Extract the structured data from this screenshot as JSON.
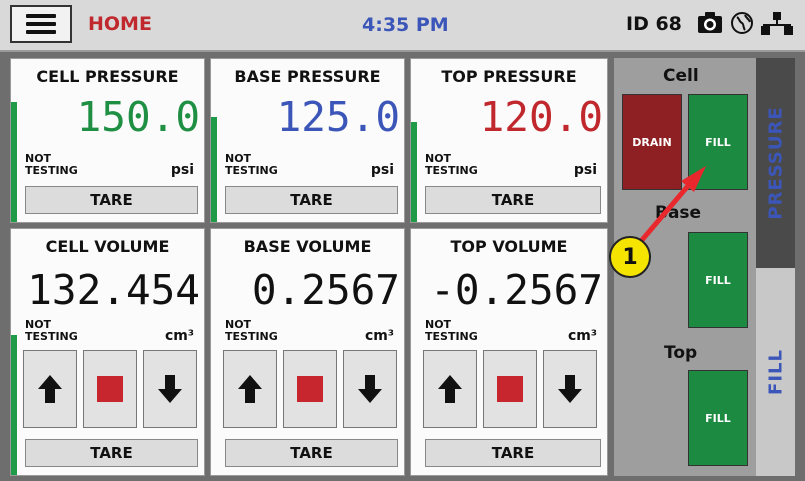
{
  "header": {
    "home": "HOME",
    "time": "4:35 PM",
    "device_id": "ID 68"
  },
  "pressure_panels": [
    {
      "title": "CELL PRESSURE",
      "value": "150.0",
      "status_l1": "NOT",
      "status_l2": "TESTING",
      "unit": "psi",
      "tare": "TARE",
      "color": "#1f8f43"
    },
    {
      "title": "BASE PRESSURE",
      "value": "125.0",
      "status_l1": "NOT",
      "status_l2": "TESTING",
      "unit": "psi",
      "tare": "TARE",
      "color": "#3b56b8"
    },
    {
      "title": "TOP PRESSURE",
      "value": "120.0",
      "status_l1": "NOT",
      "status_l2": "TESTING",
      "unit": "psi",
      "tare": "TARE",
      "color": "#c0282d"
    }
  ],
  "volume_panels": [
    {
      "title": "CELL VOLUME",
      "value": "132.454",
      "status_l1": "NOT",
      "status_l2": "TESTING",
      "unit": "cm³",
      "tare": "TARE"
    },
    {
      "title": "BASE VOLUME",
      "value": "0.2567",
      "status_l1": "NOT",
      "status_l2": "TESTING",
      "unit": "cm³",
      "tare": "TARE"
    },
    {
      "title": "TOP VOLUME",
      "value": "-0.2567",
      "status_l1": "NOT",
      "status_l2": "TESTING",
      "unit": "cm³",
      "tare": "TARE"
    }
  ],
  "side": {
    "cell_label": "Cell",
    "base_label": "Base",
    "top_label": "Top",
    "drain_label": "DRAIN",
    "cell_fill_label": "FILL",
    "base_fill_label": "FILL",
    "top_fill_label": "FILL",
    "tab_pressure": "PRESSURE",
    "tab_fill": "FILL"
  },
  "annotation": {
    "number": "1"
  }
}
